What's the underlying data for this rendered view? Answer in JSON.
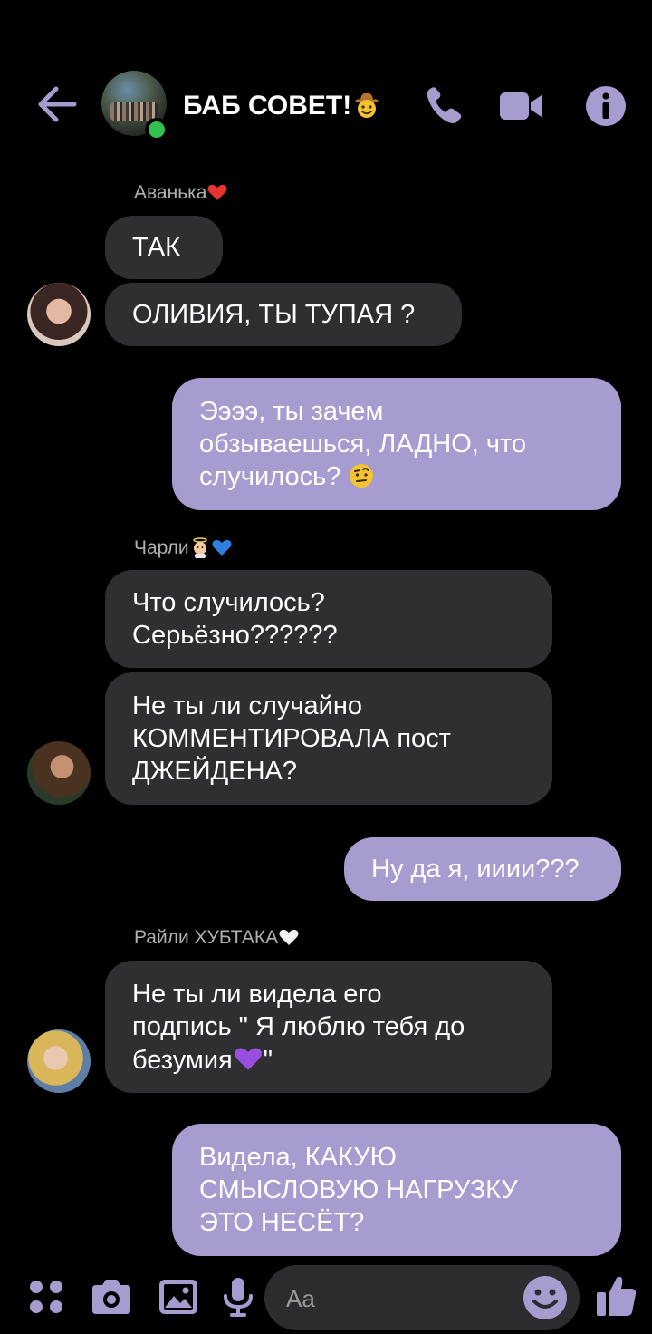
{
  "header": {
    "title": "БАБ СОВЕТ!",
    "title_emoji": "cowboy-face-emoji",
    "online": true,
    "accent_color": "#a79cd0"
  },
  "messages": [
    {
      "type": "sender",
      "name": "Аванька",
      "emoji": "red-heart-emoji"
    },
    {
      "type": "in",
      "text": "ТАК"
    },
    {
      "type": "in",
      "text": "ОЛИВИЯ, ТЫ ТУПАЯ ?"
    },
    {
      "type": "out",
      "lines": [
        "Ээээ, ты зачем",
        "обзываешься, ЛАДНО, что",
        "случилось?"
      ],
      "emoji": "face-with-raised-eyebrow-emoji"
    },
    {
      "type": "sender",
      "name": "Чарли",
      "emoji": "baby-angel-and-blue-heart-emoji"
    },
    {
      "type": "in",
      "lines": [
        "Что случилось?",
        "Серьёзно??????"
      ]
    },
    {
      "type": "in",
      "lines": [
        "Не ты ли случайно",
        "КОММЕНТИРОВАЛА пост",
        "ДЖЕЙДЕНА?"
      ]
    },
    {
      "type": "out",
      "text": "Ну да я, ииии???"
    },
    {
      "type": "sender",
      "name": "Райли ХУБТАКА",
      "emoji": "white-heart-emoji"
    },
    {
      "type": "in",
      "lines": [
        "Не ты ли видела его",
        "подпись \" Я люблю тебя до",
        "безумия",
        "\""
      ],
      "emoji": "purple-heart-emoji"
    },
    {
      "type": "out",
      "lines": [
        "Видела, КАКУЮ",
        "СМЫСЛОВУЮ НАГРУЗКУ",
        "ЭТО НЕСЁТ?"
      ]
    }
  ],
  "composer": {
    "placeholder": "Aa"
  },
  "icons": {
    "back": "arrow-left-icon",
    "call": "phone-icon",
    "video": "video-camera-icon",
    "info": "info-icon",
    "apps": "four-dots-icon",
    "camera": "camera-icon",
    "gallery": "image-icon",
    "mic": "microphone-icon",
    "emoji": "smiley-icon",
    "like": "thumbs-up-icon"
  }
}
